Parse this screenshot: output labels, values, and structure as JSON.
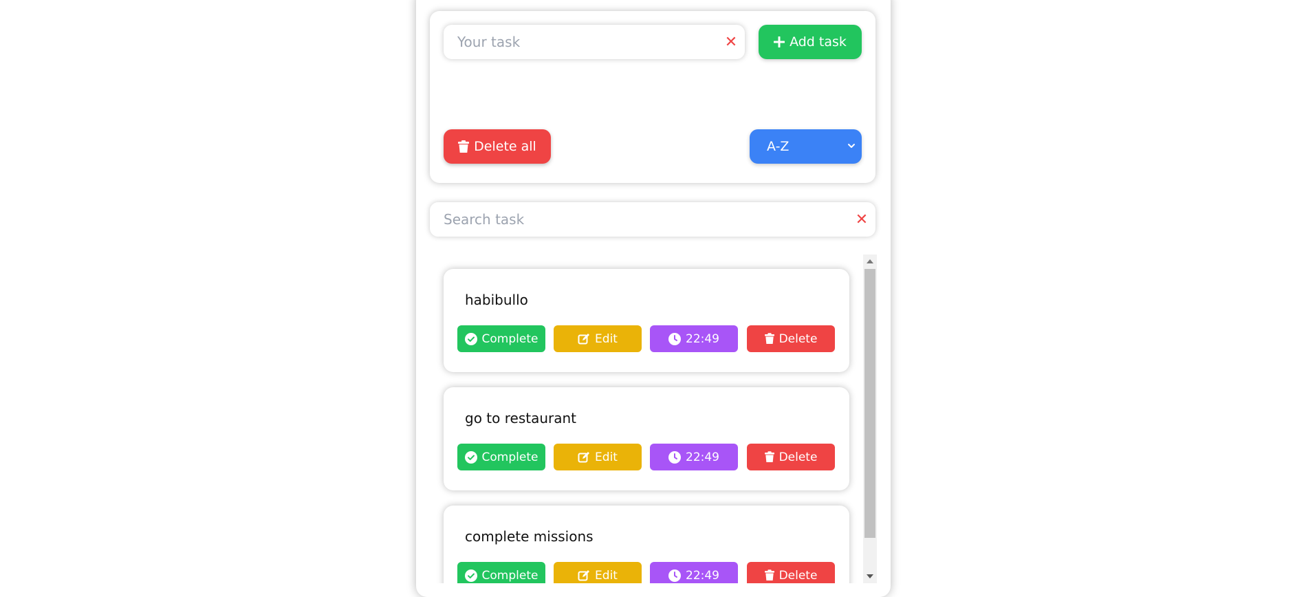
{
  "new_task": {
    "placeholder": "Your task",
    "value": "",
    "add_label": "Add task"
  },
  "controls": {
    "delete_all_label": "Delete all",
    "sort_selected": "A-Z"
  },
  "search": {
    "placeholder": "Search task",
    "value": ""
  },
  "colors": {
    "green": "#22c55e",
    "yellow": "#eab308",
    "purple": "#a855f7",
    "red": "#ef4444",
    "blue": "#3b82f6"
  },
  "tasks": [
    {
      "title": "habibullo",
      "complete_label": "Complete",
      "edit_label": "Edit",
      "time": "22:49",
      "delete_label": "Delete"
    },
    {
      "title": "go to restaurant",
      "complete_label": "Complete",
      "edit_label": "Edit",
      "time": "22:49",
      "delete_label": "Delete"
    },
    {
      "title": "complete missions",
      "complete_label": "Complete",
      "edit_label": "Edit",
      "time": "22:49",
      "delete_label": "Delete"
    }
  ]
}
